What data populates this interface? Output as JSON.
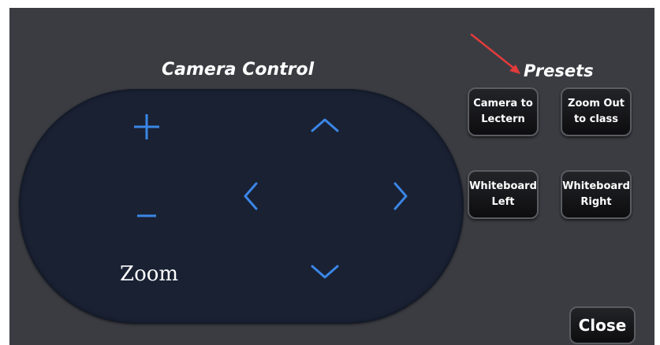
{
  "camera_control": {
    "title": "Camera Control",
    "zoom_label": "Zoom",
    "buttons": {
      "zoom_in": "zoom-in",
      "zoom_out": "zoom-out",
      "pan_up": "up",
      "pan_down": "down",
      "pan_left": "left",
      "pan_right": "right"
    }
  },
  "presets": {
    "title": "Presets",
    "items": [
      {
        "line1": "Camera to",
        "line2": "Lectern"
      },
      {
        "line1": "Zoom Out",
        "line2": "to class"
      },
      {
        "line1": "Whiteboard",
        "line2": "Left"
      },
      {
        "line1": "Whiteboard",
        "line2": "Right"
      }
    ]
  },
  "close_label": "Close",
  "colors": {
    "panel_bg": "#3a3c42",
    "pill_bg": "#192133",
    "control_icon": "#3b86e6",
    "annotation_arrow": "#e23b3b"
  }
}
